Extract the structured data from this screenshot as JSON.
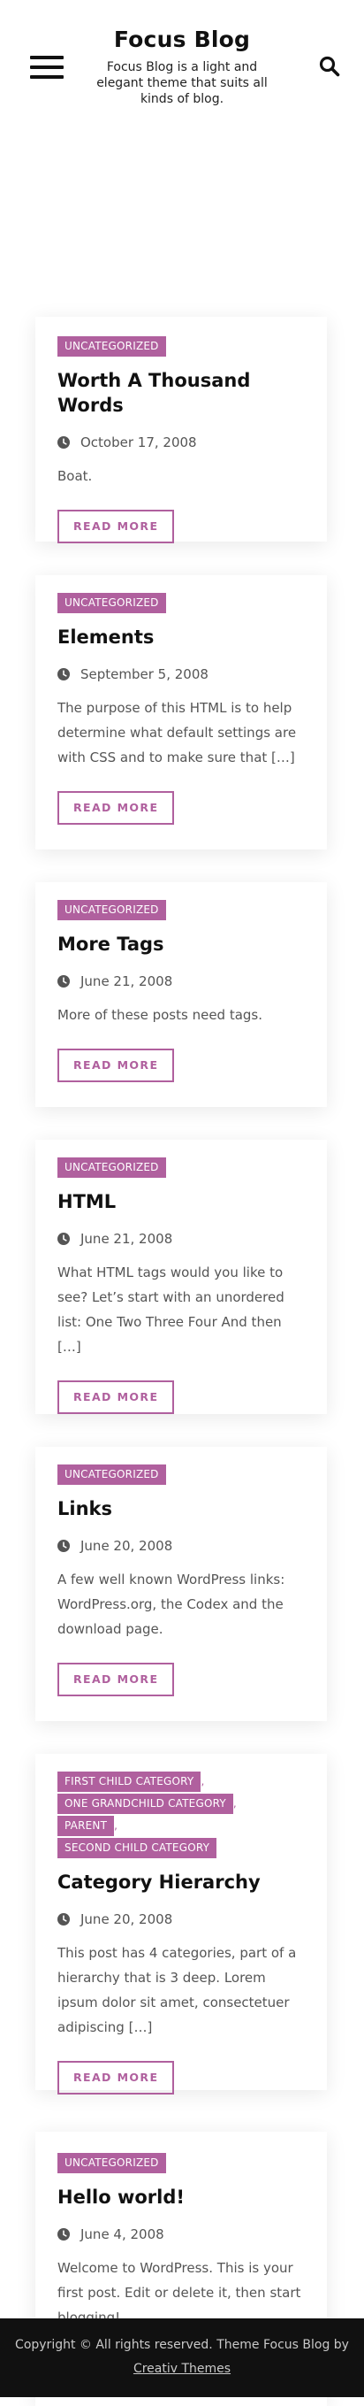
{
  "site": {
    "title": "Focus Blog",
    "description": "Focus Blog is a light and elegant theme that suits all kinds of blog."
  },
  "icons": {
    "menu": "hamburger-menu-icon",
    "search": "search-icon",
    "date": "clock-icon"
  },
  "colors": {
    "accent": "#b0609e",
    "footer_bg": "#111111"
  },
  "read_more_label": "READ MORE",
  "posts": [
    {
      "categories": [
        "UNCATEGORIZED"
      ],
      "title": "Worth A Thousand Words",
      "date": "October 17, 2008",
      "excerpt": "Boat."
    },
    {
      "categories": [
        "UNCATEGORIZED"
      ],
      "title": "Elements",
      "date": "September 5, 2008",
      "excerpt": "The purpose of this HTML is to help determine what default settings are with CSS and to make sure that […]"
    },
    {
      "categories": [
        "UNCATEGORIZED"
      ],
      "title": "More Tags",
      "date": "June 21, 2008",
      "excerpt": "More of these posts need tags."
    },
    {
      "categories": [
        "UNCATEGORIZED"
      ],
      "title": "HTML",
      "date": "June 21, 2008",
      "excerpt": "What HTML tags would you like to see? Let’s start with an unordered list: One Two Three Four And then […]"
    },
    {
      "categories": [
        "UNCATEGORIZED"
      ],
      "title": "Links",
      "date": "June 20, 2008",
      "excerpt": "A few well known WordPress links: WordPress.org, the Codex and the download page."
    },
    {
      "categories": [
        "FIRST CHILD CATEGORY",
        "ONE GRANDCHILD CATEGORY",
        "PARENT",
        "SECOND CHILD CATEGORY"
      ],
      "title": "Category Hierarchy",
      "date": "June 20, 2008",
      "excerpt": "This post has 4 categories, part of a hierarchy that is 3 deep. Lorem ipsum dolor sit amet, consectetuer adipiscing […]"
    },
    {
      "categories": [
        "UNCATEGORIZED"
      ],
      "title": "Hello world!",
      "date": "June 4, 2008",
      "excerpt": "Welcome to WordPress. This is your first post. Edit or delete it, then start blogging!"
    }
  ],
  "footer": {
    "text": "Copyright © All rights reserved. Theme Focus Blog by",
    "link": "Creativ Themes"
  }
}
